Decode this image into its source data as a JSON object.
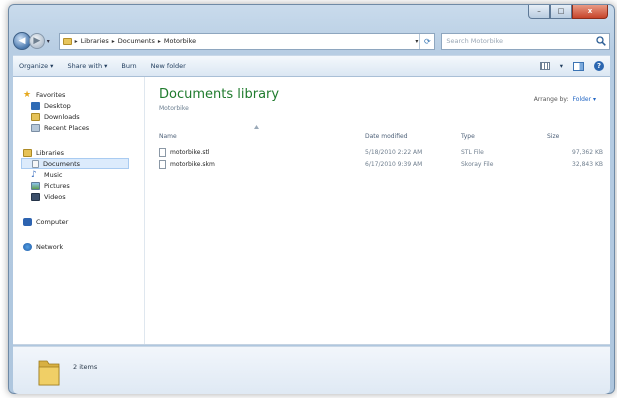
{
  "window": {
    "minimize_glyph": "–",
    "maximize_glyph": "□",
    "close_glyph": "x"
  },
  "address": {
    "crumbs": [
      "Libraries",
      "Documents",
      "Motorbike"
    ],
    "search_placeholder": "Search Motorbike"
  },
  "toolbar": {
    "organize": "Organize ▾",
    "share_with": "Share with ▾",
    "burn": "Burn",
    "new_folder": "New folder"
  },
  "sidebar": {
    "favorites": "Favorites",
    "desktop": "Desktop",
    "downloads": "Downloads",
    "recent_places": "Recent Places",
    "libraries": "Libraries",
    "documents": "Documents",
    "music": "Music",
    "pictures": "Pictures",
    "videos": "Videos",
    "computer": "Computer",
    "network": "Network"
  },
  "library": {
    "title": "Documents library",
    "subtitle": "Motorbike",
    "arrange_label": "Arrange by:",
    "arrange_value": "Folder ▾"
  },
  "columns": {
    "name": "Name",
    "date": "Date modified",
    "type": "Type",
    "size": "Size"
  },
  "files": [
    {
      "name": "motorbike.stl",
      "date": "5/18/2010 2:22 AM",
      "type": "STL File",
      "size": "97,362 KB"
    },
    {
      "name": "motorbike.skm",
      "date": "6/17/2010 9:39 AM",
      "type": "Skoray File",
      "size": "32,843 KB"
    }
  ],
  "details": {
    "count": "2 items"
  }
}
